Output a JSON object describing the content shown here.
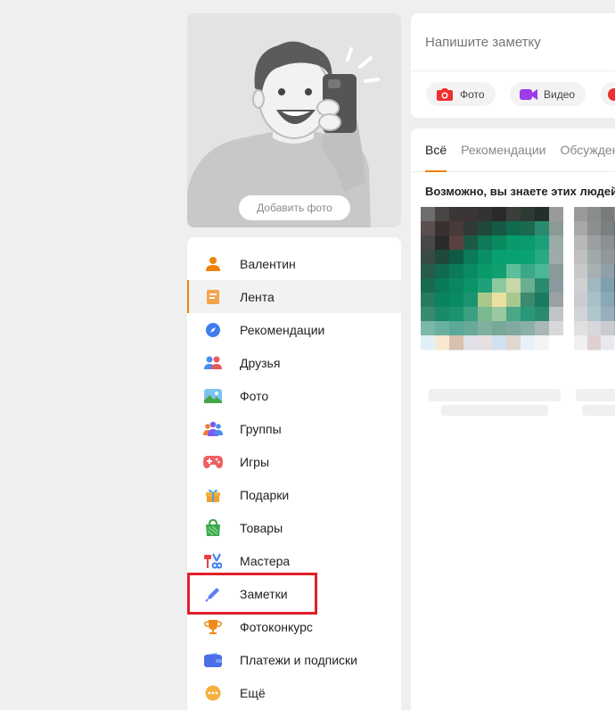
{
  "profile": {
    "add_photo_label": "Добавить фото"
  },
  "sidebar": {
    "items": [
      {
        "label": "Валентин",
        "icon": "user-icon",
        "color": "#ee8208"
      },
      {
        "label": "Лента",
        "icon": "feed-icon",
        "color": "#f5a24a",
        "active": true
      },
      {
        "label": "Рекомендации",
        "icon": "compass-icon",
        "color": "#3d7df0"
      },
      {
        "label": "Друзья",
        "icon": "friends-icon",
        "color": "#e85a5a"
      },
      {
        "label": "Фото",
        "icon": "photo-icon",
        "color": "#4aa3e8"
      },
      {
        "label": "Группы",
        "icon": "groups-icon",
        "color": "#7b5cf0"
      },
      {
        "label": "Игры",
        "icon": "gamepad-icon",
        "color": "#f06060"
      },
      {
        "label": "Подарки",
        "icon": "gift-icon",
        "color": "#f0a030"
      },
      {
        "label": "Товары",
        "icon": "shopping-bag-icon",
        "color": "#3aa84a"
      },
      {
        "label": "Мастера",
        "icon": "tools-icon",
        "color": "#e84040"
      },
      {
        "label": "Заметки",
        "icon": "pen-icon",
        "color": "#5b7df0"
      },
      {
        "label": "Фотоконкурс",
        "icon": "trophy-icon",
        "color": "#f08a1a"
      },
      {
        "label": "Платежи и подписки",
        "icon": "wallet-icon",
        "color": "#4a6ee8"
      },
      {
        "label": "Ещё",
        "icon": "more-icon",
        "color": "#f5b040"
      }
    ]
  },
  "composer": {
    "placeholder": "Напишите заметку",
    "actions": [
      {
        "label": "Фото",
        "icon": "camera-icon",
        "color": "#ee3030"
      },
      {
        "label": "Видео",
        "icon": "video-camera-icon",
        "color": "#9b3ce8"
      }
    ]
  },
  "feed": {
    "tabs": [
      "Всё",
      "Рекомендации",
      "Обсуждения"
    ],
    "active_tab": "Всё",
    "suggestions_heading": "Возможно, вы знаете этих людей"
  },
  "colors": {
    "accent": "#ee8208",
    "highlight": "#e2202b"
  }
}
